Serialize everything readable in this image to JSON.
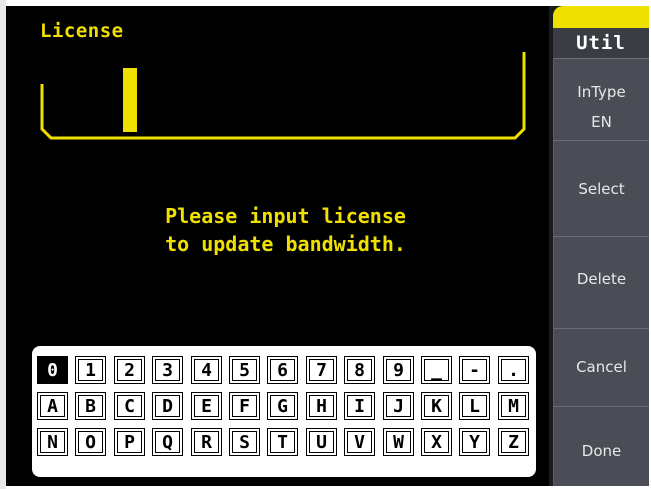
{
  "license": {
    "title": "License",
    "message_line1": "Please input license",
    "message_line2": "to update bandwidth."
  },
  "keyboard": {
    "selected_key": "0",
    "rows": [
      [
        "0",
        "1",
        "2",
        "3",
        "4",
        "5",
        "6",
        "7",
        "8",
        "9",
        "_",
        "-",
        "."
      ],
      [
        "A",
        "B",
        "C",
        "D",
        "E",
        "F",
        "G",
        "H",
        "I",
        "J",
        "K",
        "L",
        "M"
      ],
      [
        "N",
        "O",
        "P",
        "Q",
        "R",
        "S",
        "T",
        "U",
        "V",
        "W",
        "X",
        "Y",
        "Z"
      ]
    ]
  },
  "sidebar": {
    "header": "Util",
    "intype_label": "InType",
    "intype_value": "EN",
    "select_label": "Select",
    "delete_label": "Delete",
    "cancel_label": "Cancel",
    "done_label": "Done"
  },
  "colors": {
    "accent_yellow": "#f0e000",
    "screen_bg": "#000000",
    "button_bg": "#4a4d55"
  }
}
